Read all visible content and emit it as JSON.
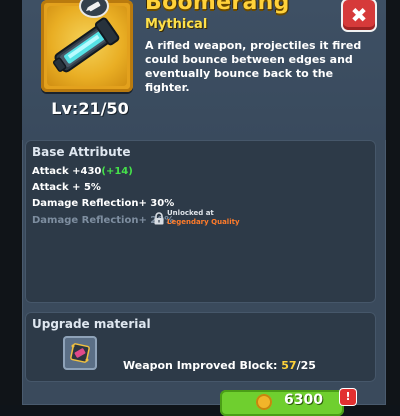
{
  "weapon": {
    "name": "Boomerang",
    "rarity": "Mythical",
    "description": "A rifled weapon, projectiles it fired could bounce between edges and eventually bounce back to the fighter.",
    "level": "Lv:21/50"
  },
  "close_label": "✖",
  "base_attribute": {
    "title": "Base Attribute",
    "rows": [
      {
        "text": "Attack +430",
        "bonus": "(+14)"
      },
      {
        "text": "Attack + 5%"
      },
      {
        "text": "Damage Reflection+ 30%"
      },
      {
        "text": "Damage Reflection+ 20%",
        "locked": true
      }
    ],
    "unlock_line1": "Unlocked at",
    "unlock_line2": "Legendary Quality"
  },
  "upgrade": {
    "title": "Upgrade material",
    "material_label": "Weapon Improved Block: ",
    "have": "57",
    "need": "/25"
  },
  "action": {
    "price": "6300",
    "notify": "!"
  },
  "colors": {
    "title_gold": "#ffd23a",
    "bonus_green": "#45e04a",
    "legendary_orange": "#ff7b2a",
    "close_red": "#d63a3a",
    "button_green": "#6fcf2f"
  }
}
